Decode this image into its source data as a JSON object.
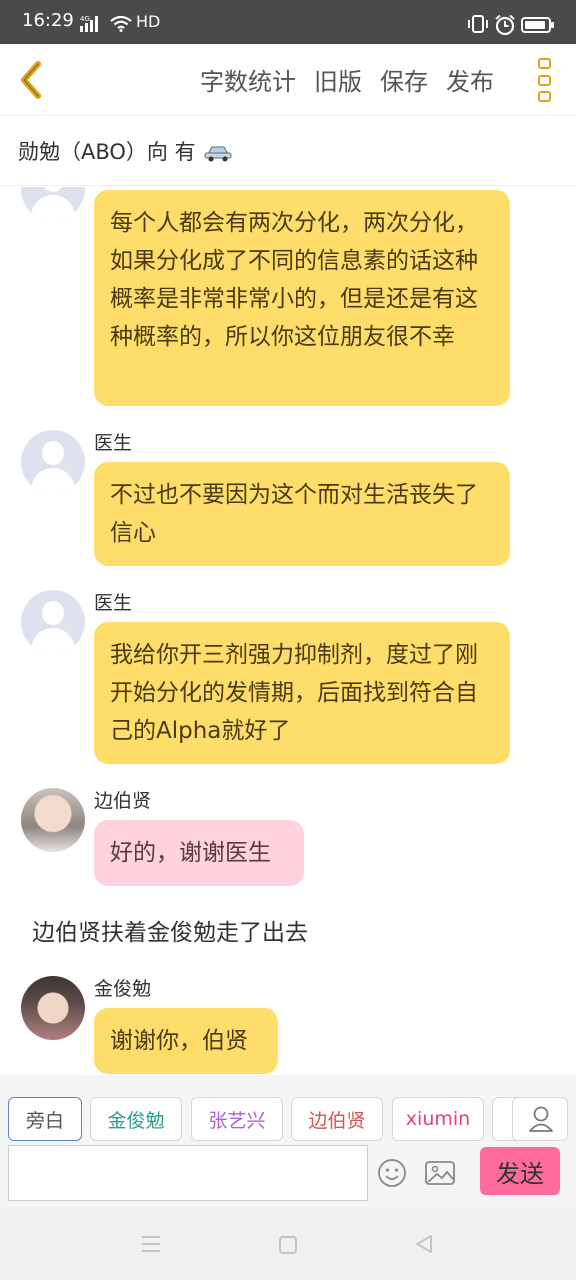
{
  "status_bar": {
    "time": "16:29",
    "network": "4G",
    "hd": "HD"
  },
  "header": {
    "actions": [
      "字数统计",
      "旧版",
      "保存",
      "发布"
    ],
    "accent_color": "#d9a51c"
  },
  "story": {
    "title": "勋勉（ABO）向 有"
  },
  "messages": [
    {
      "speaker": "",
      "text": "每个人都会有两次分化，两次分化，如果分化成了不同的信息素的话这种概率是非常非常小的，但是还是有这种概率的，所以你这位朋友很不幸"
    },
    {
      "speaker": "医生",
      "text": "不过也不要因为这个而对生活丧失了信心"
    },
    {
      "speaker": "医生",
      "text": "我给你开三剂强力抑制剂，度过了刚开始分化的发情期，后面找到符合自己的Alpha就好了"
    },
    {
      "speaker": "边伯贤",
      "text": "好的，谢谢医生"
    },
    {
      "narration": "边伯贤扶着金俊勉走了出去"
    },
    {
      "speaker": "金俊勉",
      "text": "谢谢你，伯贤"
    }
  ],
  "characters": [
    {
      "name": "旁白",
      "color": "#555555"
    },
    {
      "name": "金俊勉",
      "color": "#2aa198"
    },
    {
      "name": "张艺兴",
      "color": "#b05fd0"
    },
    {
      "name": "边伯贤",
      "color": "#d9534f"
    },
    {
      "name": "xiumin",
      "color": "#d94a6b"
    }
  ],
  "composer": {
    "input_value": "",
    "send_label": "发送",
    "send_color": "#ff6b9d"
  },
  "bubble_colors": {
    "default": "#ffdd6b",
    "pink": "#ffd2dd"
  }
}
